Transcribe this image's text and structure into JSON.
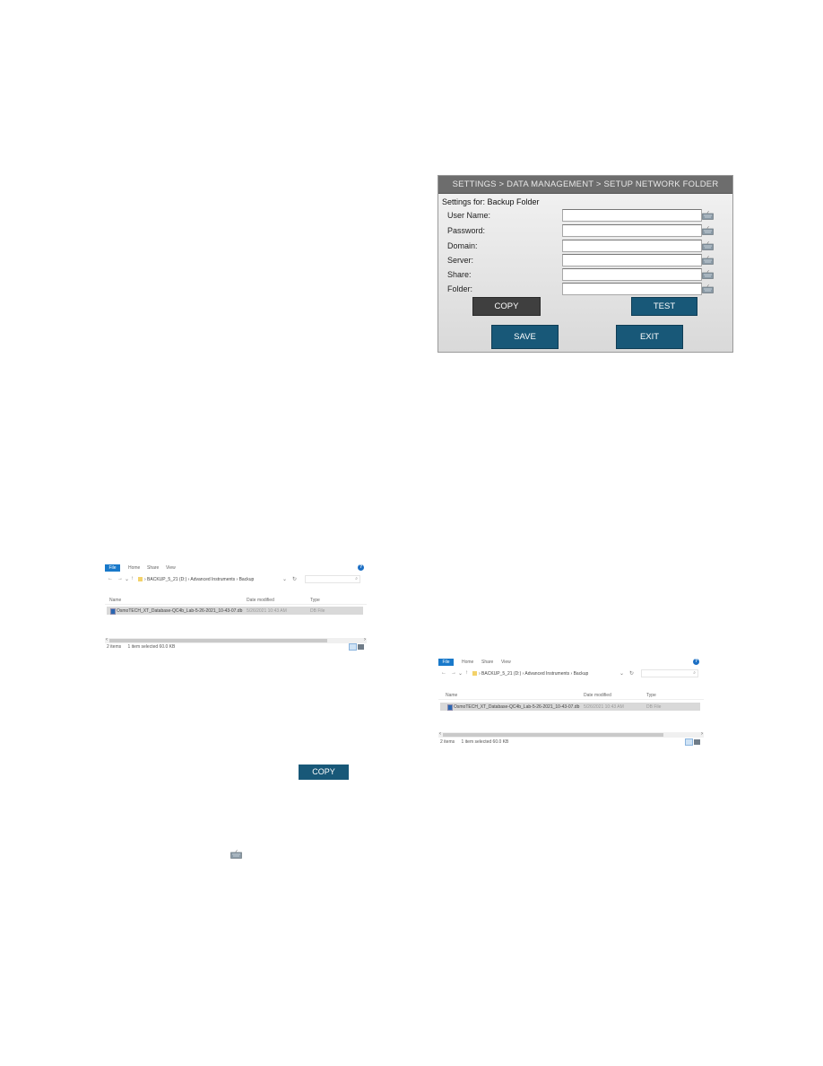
{
  "settings_panel": {
    "breadcrumb": "SETTINGS > DATA MANAGEMENT > SETUP NETWORK FOLDER",
    "settings_for": "Settings for: Backup Folder",
    "fields": [
      {
        "label": "User Name:",
        "value": ""
      },
      {
        "label": "Password:",
        "value": ""
      },
      {
        "label": "Domain:",
        "value": ""
      },
      {
        "label": "Server:",
        "value": ""
      },
      {
        "label": "Share:",
        "value": ""
      },
      {
        "label": "Folder:",
        "value": ""
      }
    ],
    "buttons": {
      "copy": "COPY",
      "test": "TEST",
      "save": "SAVE",
      "exit": "EXIT"
    },
    "icons": {
      "keyboard": "keyboard-icon"
    }
  },
  "explorer": {
    "tabs": [
      "File",
      "Home",
      "Share",
      "View"
    ],
    "help": "?",
    "nav": {
      "back": "←",
      "forward": "→",
      "recent": "⌄",
      "up": "↑",
      "dropdown": "⌄",
      "refresh": "↻"
    },
    "path": "›  BACKUP_5_21 (D:)  ›  Advanced Instruments  ›  Backup",
    "search_icon": "⌕",
    "columns": [
      "Name",
      "Date modified",
      "Type"
    ],
    "files": [
      {
        "name": "OsmoTECH_XT_Database-QC4b_Lab-5-26-2021_10-43-07.db",
        "date": "5/26/2021 10:43 AM",
        "type": "DB File"
      }
    ],
    "status": {
      "count": "2 items",
      "selected": "1 item selected  60.0 KB"
    },
    "scroll_left": "‹",
    "scroll_right": "›"
  },
  "inline": {
    "copy_button": "COPY"
  },
  "colors": {
    "button_blue": "#185878",
    "button_dark": "#3f3f3f",
    "header_gray": "#6d6d6d",
    "explorer_accent": "#1979ca"
  }
}
